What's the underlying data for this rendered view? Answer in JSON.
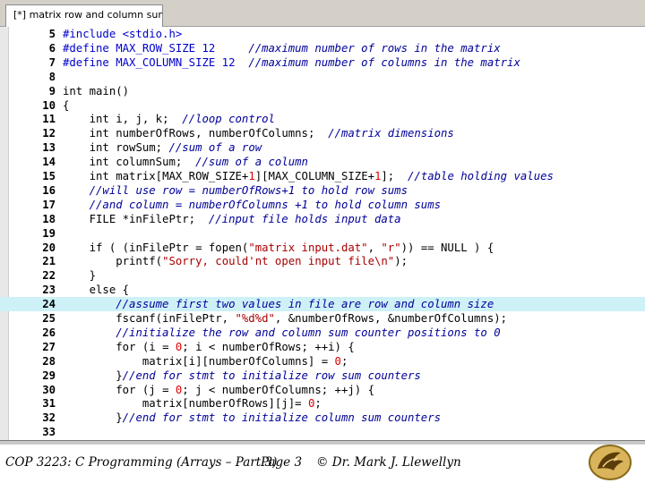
{
  "window": {
    "tab_title": "[*] matrix row and column sums.c"
  },
  "editor": {
    "current_line": "24",
    "lines": [
      {
        "num": "5",
        "tokens": [
          {
            "t": "pp",
            "s": "#include <stdio.h>"
          }
        ]
      },
      {
        "num": "6",
        "tokens": [
          {
            "t": "pp",
            "s": "#define MAX_ROW_SIZE 12"
          },
          {
            "t": "tx",
            "s": "     "
          },
          {
            "t": "cm",
            "s": "//maximum number of rows in the matrix"
          }
        ]
      },
      {
        "num": "7",
        "tokens": [
          {
            "t": "pp",
            "s": "#define MAX_COLUMN_SIZE 12"
          },
          {
            "t": "tx",
            "s": "  "
          },
          {
            "t": "cm",
            "s": "//maximum number of columns in the matrix"
          }
        ]
      },
      {
        "num": "8",
        "tokens": []
      },
      {
        "num": "9",
        "tokens": [
          {
            "t": "kw",
            "s": "int"
          },
          {
            "t": "tx",
            "s": " main()"
          }
        ]
      },
      {
        "num": "10",
        "tokens": [
          {
            "t": "tx",
            "s": "{"
          }
        ]
      },
      {
        "num": "11",
        "tokens": [
          {
            "t": "tx",
            "s": "    "
          },
          {
            "t": "kw",
            "s": "int"
          },
          {
            "t": "tx",
            "s": " i, j, k;  "
          },
          {
            "t": "cm",
            "s": "//loop control"
          }
        ]
      },
      {
        "num": "12",
        "tokens": [
          {
            "t": "tx",
            "s": "    "
          },
          {
            "t": "kw",
            "s": "int"
          },
          {
            "t": "tx",
            "s": " numberOfRows, numberOfColumns;  "
          },
          {
            "t": "cm",
            "s": "//matrix dimensions"
          }
        ]
      },
      {
        "num": "13",
        "tokens": [
          {
            "t": "tx",
            "s": "    "
          },
          {
            "t": "kw",
            "s": "int"
          },
          {
            "t": "tx",
            "s": " rowSum; "
          },
          {
            "t": "cm",
            "s": "//sum of a row"
          }
        ]
      },
      {
        "num": "14",
        "tokens": [
          {
            "t": "tx",
            "s": "    "
          },
          {
            "t": "kw",
            "s": "int"
          },
          {
            "t": "tx",
            "s": " columnSum;  "
          },
          {
            "t": "cm",
            "s": "//sum of a column"
          }
        ]
      },
      {
        "num": "15",
        "tokens": [
          {
            "t": "tx",
            "s": "    "
          },
          {
            "t": "kw",
            "s": "int"
          },
          {
            "t": "tx",
            "s": " matrix[MAX_ROW_SIZE+"
          },
          {
            "t": "nm",
            "s": "1"
          },
          {
            "t": "tx",
            "s": "][MAX_COLUMN_SIZE+"
          },
          {
            "t": "nm",
            "s": "1"
          },
          {
            "t": "tx",
            "s": "];  "
          },
          {
            "t": "cm",
            "s": "//table holding values"
          }
        ]
      },
      {
        "num": "16",
        "tokens": [
          {
            "t": "tx",
            "s": "    "
          },
          {
            "t": "cm",
            "s": "//will use row = numberOfRows+1 to hold row sums"
          }
        ]
      },
      {
        "num": "17",
        "tokens": [
          {
            "t": "tx",
            "s": "    "
          },
          {
            "t": "cm",
            "s": "//and column = numberOfColumns +1 to hold column sums"
          }
        ]
      },
      {
        "num": "18",
        "tokens": [
          {
            "t": "tx",
            "s": "    FILE *inFilePtr;  "
          },
          {
            "t": "cm",
            "s": "//input file holds input data"
          }
        ]
      },
      {
        "num": "19",
        "tokens": []
      },
      {
        "num": "20",
        "tokens": [
          {
            "t": "tx",
            "s": "    "
          },
          {
            "t": "kw",
            "s": "if"
          },
          {
            "t": "tx",
            "s": " ( (inFilePtr = fopen("
          },
          {
            "t": "st",
            "s": "\"matrix input.dat\""
          },
          {
            "t": "tx",
            "s": ", "
          },
          {
            "t": "st",
            "s": "\"r\""
          },
          {
            "t": "tx",
            "s": ")) == NULL ) {"
          }
        ]
      },
      {
        "num": "21",
        "tokens": [
          {
            "t": "tx",
            "s": "        printf("
          },
          {
            "t": "st",
            "s": "\"Sorry, could'nt open input file\\n\""
          },
          {
            "t": "tx",
            "s": ");"
          }
        ]
      },
      {
        "num": "22",
        "tokens": [
          {
            "t": "tx",
            "s": "    }"
          }
        ]
      },
      {
        "num": "23",
        "tokens": [
          {
            "t": "tx",
            "s": "    "
          },
          {
            "t": "kw",
            "s": "else"
          },
          {
            "t": "tx",
            "s": " {"
          }
        ]
      },
      {
        "num": "24",
        "tokens": [
          {
            "t": "tx",
            "s": "        "
          },
          {
            "t": "cm",
            "s": "//assume first two values in file are row and column size"
          }
        ]
      },
      {
        "num": "25",
        "tokens": [
          {
            "t": "tx",
            "s": "        fscanf(inFilePtr, "
          },
          {
            "t": "st",
            "s": "\"%d%d\""
          },
          {
            "t": "tx",
            "s": ", &numberOfRows, &numberOfColumns);"
          }
        ]
      },
      {
        "num": "26",
        "tokens": [
          {
            "t": "tx",
            "s": "        "
          },
          {
            "t": "cm",
            "s": "//initialize the row and column sum counter positions to 0"
          }
        ]
      },
      {
        "num": "27",
        "tokens": [
          {
            "t": "tx",
            "s": "        "
          },
          {
            "t": "kw",
            "s": "for"
          },
          {
            "t": "tx",
            "s": " (i = "
          },
          {
            "t": "nm",
            "s": "0"
          },
          {
            "t": "tx",
            "s": "; i < numberOfRows; ++i) {"
          }
        ]
      },
      {
        "num": "28",
        "tokens": [
          {
            "t": "tx",
            "s": "            matrix[i][numberOfColumns] = "
          },
          {
            "t": "nm",
            "s": "0"
          },
          {
            "t": "tx",
            "s": ";"
          }
        ]
      },
      {
        "num": "29",
        "tokens": [
          {
            "t": "tx",
            "s": "        }"
          },
          {
            "t": "cm",
            "s": "//end for stmt to initialize row sum counters"
          }
        ]
      },
      {
        "num": "30",
        "tokens": [
          {
            "t": "tx",
            "s": "        "
          },
          {
            "t": "kw",
            "s": "for"
          },
          {
            "t": "tx",
            "s": " (j = "
          },
          {
            "t": "nm",
            "s": "0"
          },
          {
            "t": "tx",
            "s": "; j < numberOfColumns; ++j) {"
          }
        ]
      },
      {
        "num": "31",
        "tokens": [
          {
            "t": "tx",
            "s": "            matrix[numberOfRows][j]= "
          },
          {
            "t": "nm",
            "s": "0"
          },
          {
            "t": "tx",
            "s": ";"
          }
        ]
      },
      {
        "num": "32",
        "tokens": [
          {
            "t": "tx",
            "s": "        }"
          },
          {
            "t": "cm",
            "s": "//end for stmt to initialize column sum counters"
          }
        ]
      },
      {
        "num": "33",
        "tokens": []
      }
    ]
  },
  "footer": {
    "course": "COP 3223: C Programming (Arrays – Part 3)",
    "page": "Page 3",
    "author": "© Dr. Mark J. Llewellyn"
  },
  "colors": {
    "current_line_bg": "#cdf1f7",
    "preprocessor": "#0000cc",
    "comment": "#000099",
    "string": "#aa0000",
    "number": "#dd0000"
  },
  "logo": {
    "icon": "ucf-pegasus-logo"
  }
}
